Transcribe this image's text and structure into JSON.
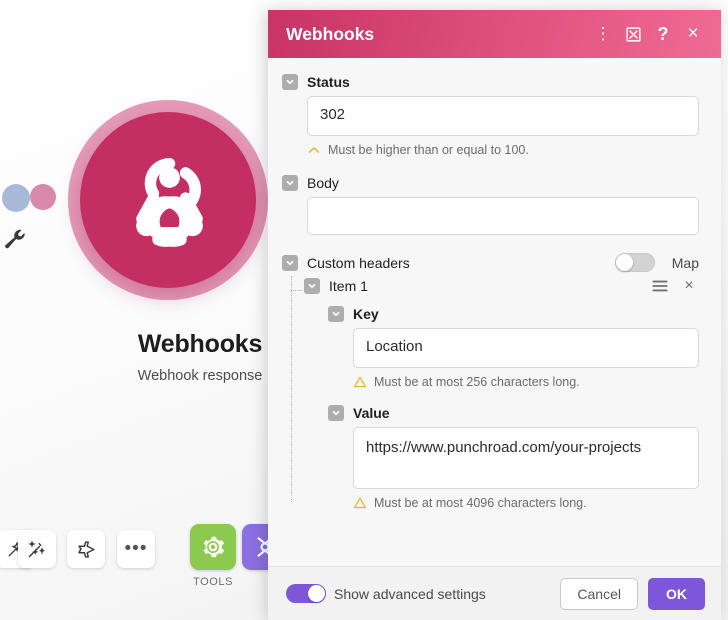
{
  "canvas": {
    "module": {
      "title": "Webhooks",
      "subtitle": "Webhook response",
      "icon": "webhook-icon",
      "color": "#c42f62"
    },
    "dots": [
      {
        "name": "dot-blue",
        "color": "#a8b8d8"
      },
      {
        "name": "dot-pink",
        "color": "#d98aab"
      }
    ],
    "wrench_icon": "wrench-icon",
    "toolbar": {
      "buttons": [
        {
          "name": "magic-wand-button",
          "icon": "magic-wand-icon"
        },
        {
          "name": "airplane-button",
          "icon": "airplane-icon"
        },
        {
          "name": "more-button",
          "icon": "ellipsis-icon",
          "label": "•••"
        }
      ],
      "tools_label": "TOOLS",
      "gear_icon": "gear-icon",
      "gear_color": "#8cc94f",
      "flow_icon": "flow-control-icon",
      "flow_color": "#8c6fe0"
    }
  },
  "dialog": {
    "title": "Webhooks",
    "header_color": "#d0436f",
    "header_icons": [
      {
        "name": "kebab-menu-icon",
        "glyph": "⋮"
      },
      {
        "name": "expand-icon",
        "glyph": "expand"
      },
      {
        "name": "help-icon",
        "glyph": "?"
      },
      {
        "name": "close-icon",
        "glyph": "×"
      }
    ],
    "status": {
      "label": "Status",
      "value": "302",
      "hint": "Must be higher than or equal to 100.",
      "hint_icon": "chevron-up-warning-icon"
    },
    "body": {
      "label": "Body",
      "value": "",
      "placeholder": ""
    },
    "custom_headers": {
      "label": "Custom headers",
      "map_label": "Map",
      "map_enabled": false,
      "item": {
        "label": "Item 1",
        "drag_icon": "hamburger-drag-icon",
        "remove_icon": "close-icon",
        "key": {
          "label": "Key",
          "value": "Location",
          "hint": "Must be at most 256 characters long.",
          "hint_icon": "warning-triangle-icon"
        },
        "value_field": {
          "label": "Value",
          "value": "https://www.punchroad.com/your-projects",
          "hint": "Must be at most 4096 characters long.",
          "hint_icon": "warning-triangle-icon"
        }
      }
    },
    "footer": {
      "advanced_label": "Show advanced settings",
      "advanced_enabled": true,
      "cancel_label": "Cancel",
      "ok_label": "OK",
      "accent_color": "#7e57d8"
    }
  }
}
